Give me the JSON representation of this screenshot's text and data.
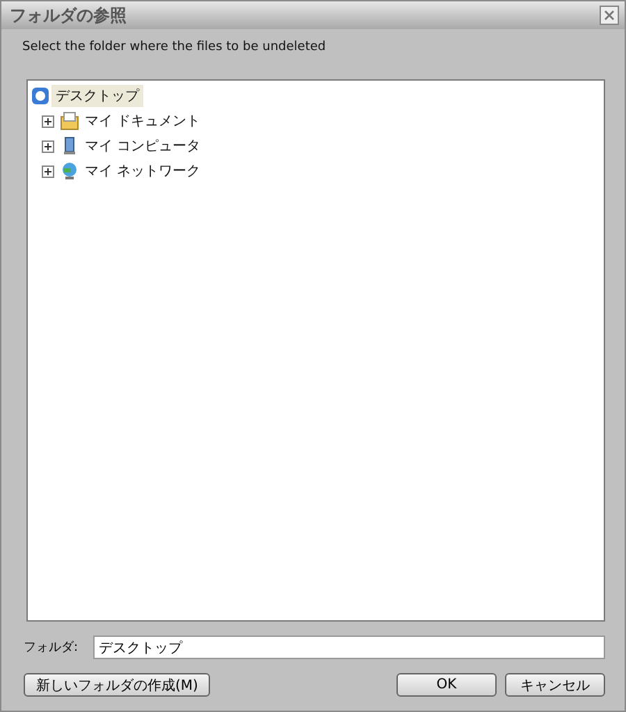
{
  "window": {
    "title": "フォルダの参照"
  },
  "prompt": "Select the folder where the files to be undeleted",
  "tree": [
    {
      "label": "デスクトップ",
      "kind": "desktop",
      "selected": true,
      "children": [
        {
          "label": "マイ ドキュメント",
          "kind": "documents",
          "selected": false,
          "expanded": false
        },
        {
          "label": "マイ コンピュータ",
          "kind": "computer",
          "selected": false,
          "expanded": false
        },
        {
          "label": "マイ ネットワーク",
          "kind": "network",
          "selected": false,
          "expanded": false
        }
      ]
    }
  ],
  "folder_field": {
    "label": "フォルダ:",
    "value": "デスクトップ"
  },
  "buttons": [
    {
      "label": "新しいフォルダの作成(M)",
      "kind": "left"
    },
    {
      "label": "OK",
      "kind": "right"
    },
    {
      "label": "キャンセル",
      "kind": "right"
    }
  ]
}
